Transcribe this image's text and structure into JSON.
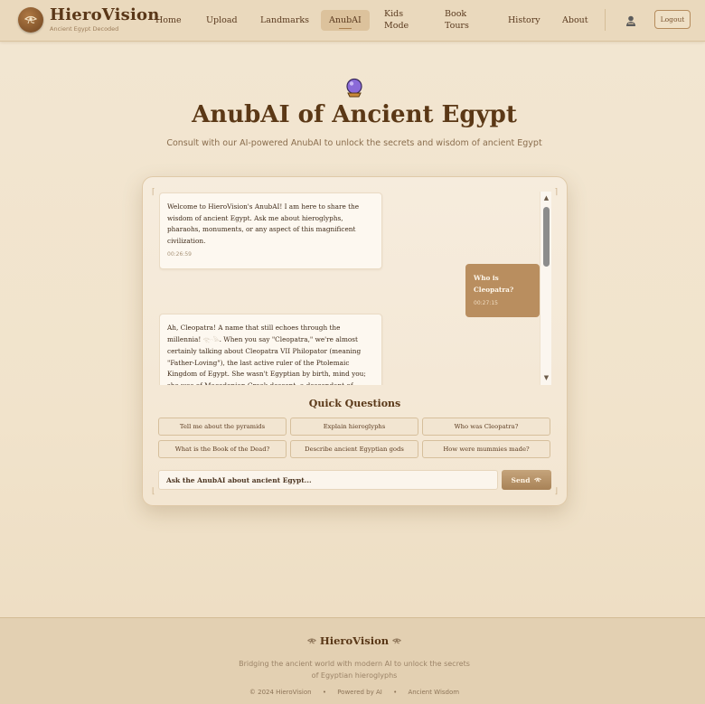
{
  "header": {
    "brand": "HieroVision",
    "tagline": "Ancient Egypt Decoded",
    "logo_icon": "eye-of-horus-icon",
    "nav": [
      {
        "label": "Home",
        "active": false
      },
      {
        "label": "Upload",
        "active": false
      },
      {
        "label": "Landmarks",
        "active": false
      },
      {
        "label": "AnubAI",
        "active": true
      },
      {
        "label": "Kids Mode",
        "active": false
      },
      {
        "label": "Book Tours",
        "active": false
      },
      {
        "label": "History",
        "active": false
      },
      {
        "label": "About",
        "active": false
      }
    ],
    "user_icon": "user-icon",
    "logout_label": "Logout"
  },
  "hero": {
    "icon": "crystal-ball-icon",
    "title": "AnubAI of Ancient Egypt",
    "subtitle": "Consult with our AI-powered AnubAI to unlock the secrets and wisdom of ancient Egypt"
  },
  "chat": {
    "messages": [
      {
        "role": "bot",
        "text": "Welcome to HieroVision's AnubAI! I am here to share the wisdom of ancient Egypt. Ask me about hieroglyphs, pharaohs, monuments, or any aspect of this magnificent civilization.",
        "time": "00:26:59"
      },
      {
        "role": "user",
        "text": "Who is Cleopatra?",
        "time": "00:27:15"
      },
      {
        "role": "bot",
        "text_before": "Ah, Cleopatra! A name that still echoes through the millennia!",
        "hieroglyphs": "𓂀𓏏𓅃",
        "text_after": ". When you say \"Cleopatra,\" we're almost certainly talking about Cleopatra VII Philopator (meaning \"Father-Loving\"), the last active ruler of the Ptolemaic Kingdom of Egypt. She wasn't Egyptian by birth, mind you; she was of Macedonian Greek descent, a descendant of Ptolemy I Soter, one of Alexander the"
      }
    ]
  },
  "quick_questions": {
    "title": "Quick Questions",
    "items": [
      "Tell me about the pyramids",
      "Explain hieroglyphs",
      "Who was Cleopatra?",
      "What is the Book of the Dead?",
      "Describe ancient Egyptian gods",
      "How were mummies made?"
    ]
  },
  "input": {
    "placeholder": "Ask the AnubAI about ancient Egypt...",
    "send_label": "Send",
    "send_icon": "eye-of-horus-icon"
  },
  "footer": {
    "brand": "HieroVision",
    "brand_icon": "eye-of-horus-icon",
    "tagline": "Bridging the ancient world with modern AI to unlock the secrets of Egyptian hieroglyphs",
    "links": [
      "© 2024 HieroVision",
      "Powered by AI",
      "Ancient Wisdom"
    ]
  },
  "colors": {
    "accent": "#b98e5f",
    "brand_text": "#5a3718",
    "background": "#f2e6d2"
  }
}
